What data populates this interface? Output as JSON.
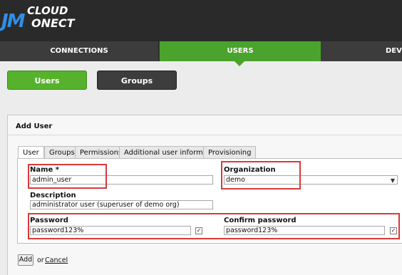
{
  "logo": {
    "part1": "JM",
    "part2": "CLOUD",
    "part3": "ONECT"
  },
  "nav": {
    "tabs": [
      "CONNECTIONS",
      "USERS",
      "DEVI"
    ]
  },
  "subnav": {
    "users_label": "Users",
    "groups_label": "Groups"
  },
  "panel": {
    "title": "Add User",
    "tabs": [
      "User",
      "Groups",
      "Permissions",
      "Additional user information",
      "Provisioning"
    ],
    "active_tab": "User",
    "form": {
      "name_label": "Name *",
      "name_value": "admin_user",
      "org_label": "Organization",
      "org_value": "demo",
      "desc_label": "Description",
      "desc_value": "administrator user (superuser of demo org)",
      "password_label": "Password",
      "password_value": "password123%",
      "confirm_label": "Confirm password",
      "confirm_value": "password123%"
    },
    "add_label": "Add",
    "or_label": "or",
    "cancel_label": "Cancel"
  },
  "colors": {
    "accent": "#4aa32c",
    "header": "#2a2a2a",
    "highlight": "#d9393a"
  }
}
